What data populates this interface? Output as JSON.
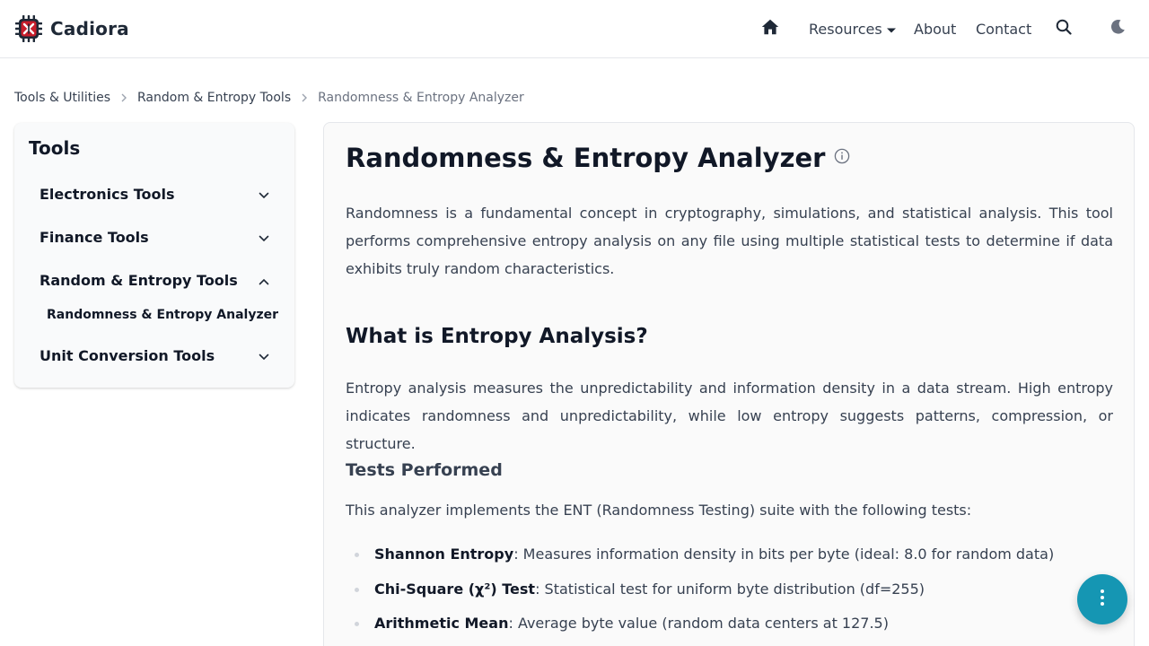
{
  "header": {
    "logo_text": "Cadiora",
    "nav": {
      "resources": "Resources",
      "about": "About",
      "contact": "Contact"
    }
  },
  "breadcrumb": {
    "items": [
      "Tools & Utilities",
      "Random & Entropy Tools",
      "Randomness & Entropy Analyzer"
    ]
  },
  "sidebar": {
    "title": "Tools",
    "items": [
      {
        "label": "Electronics Tools",
        "expanded": false
      },
      {
        "label": "Finance Tools",
        "expanded": false
      },
      {
        "label": "Random & Entropy Tools",
        "expanded": true
      },
      {
        "label": "Unit Conversion Tools",
        "expanded": false
      }
    ],
    "subitem": "Randomness & Entropy Analyzer"
  },
  "main": {
    "title": "Randomness & Entropy Analyzer",
    "intro": "Randomness is a fundamental concept in cryptography, simulations, and statistical analysis. This tool performs comprehensive entropy analysis on any file using multiple statistical tests to determine if data exhibits truly random characteristics.",
    "h2": "What is Entropy Analysis?",
    "entropy_para": "Entropy analysis measures the unpredictability and information density in a data stream. High entropy indicates randomness and unpredictability, while low entropy suggests patterns, compression, or structure.",
    "h3": "Tests Performed",
    "tests_intro": "This analyzer implements the ENT (Randomness Testing) suite with the following tests:",
    "tests": [
      {
        "name": "Shannon Entropy",
        "desc": ": Measures information density in bits per byte (ideal: 8.0 for random data)"
      },
      {
        "name": "Chi-Square (χ²) Test",
        "desc": ": Statistical test for uniform byte distribution (df=255)"
      },
      {
        "name": "Arithmetic Mean",
        "desc": ": Average byte value (random data centers at 127.5)"
      }
    ]
  },
  "colors": {
    "accent": "#1596b3",
    "logo_red": "#c81e2c",
    "text_dark": "#111827",
    "text_body": "#374151"
  },
  "icons": {
    "logo": "cadiora-chip-icon",
    "home": "home-icon",
    "caret": "caret-down-icon",
    "search": "search-icon",
    "theme": "moon-icon",
    "info": "info-icon",
    "fab": "more-vertical-icon"
  }
}
